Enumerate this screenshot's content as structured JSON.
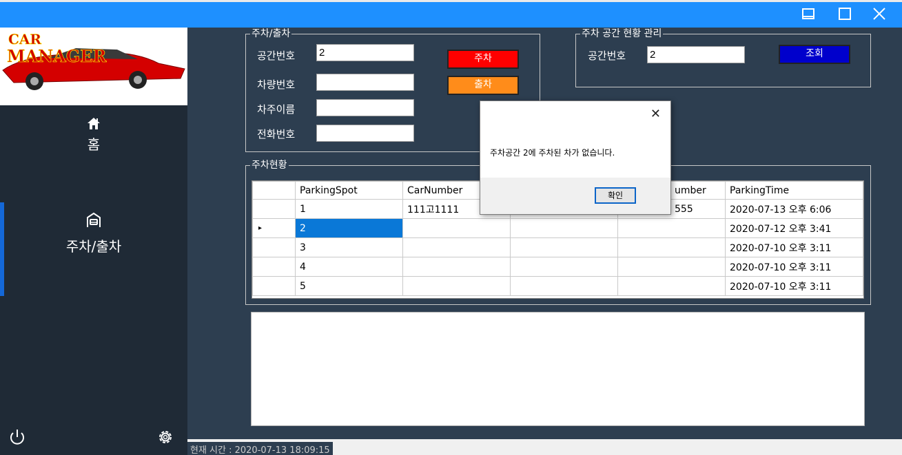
{
  "window": {
    "minimize_icon": "minimize-icon",
    "maximize_icon": "maximize-icon",
    "close_icon": "close-icon"
  },
  "sidebar": {
    "logo_text_top": "CAR",
    "logo_text_bottom": "MANAGER",
    "items": [
      {
        "label": "홈",
        "icon": "home-icon"
      },
      {
        "label": "주차/출차",
        "icon": "car-garage-icon",
        "active": true
      }
    ],
    "power_icon": "power-icon",
    "settings_icon": "gear-icon"
  },
  "parking_group": {
    "title": "주차/출차",
    "fields": [
      {
        "label": "공간번호",
        "value": "2"
      },
      {
        "label": "차량번호",
        "value": ""
      },
      {
        "label": "차주이름",
        "value": ""
      },
      {
        "label": "전화번호",
        "value": ""
      }
    ],
    "park_button": "주차",
    "exit_button": "출차",
    "colors": {
      "park": "#ff0000",
      "exit": "#ff8c1a"
    }
  },
  "lookup_group": {
    "title": "주차 공간 현황 관리",
    "label": "공간번호",
    "value": "2",
    "button": "조회",
    "button_color": "#0000cc"
  },
  "status_group": {
    "title": "주차현황",
    "columns": [
      "ParkingSpot",
      "CarNumber",
      "",
      "umber",
      "ParkingTime"
    ],
    "rows": [
      [
        "1",
        "111고1111",
        "",
        "555",
        "2020-07-13 오후 6:06"
      ],
      [
        "2",
        "",
        "",
        "",
        "2020-07-12 오후 3:41"
      ],
      [
        "3",
        "",
        "",
        "",
        "2020-07-10 오후 3:11"
      ],
      [
        "4",
        "",
        "",
        "",
        "2020-07-10 오후 3:11"
      ],
      [
        "5",
        "",
        "",
        "",
        "2020-07-10 오후 3:11"
      ]
    ],
    "current_row_indicator": "▸"
  },
  "statusbar": {
    "text": "현재 시간 : 2020-07-13 18:09:15"
  },
  "dialog": {
    "message": "주차공간 2에 주차된 차가 없습니다.",
    "ok": "확인",
    "close": "✕"
  }
}
